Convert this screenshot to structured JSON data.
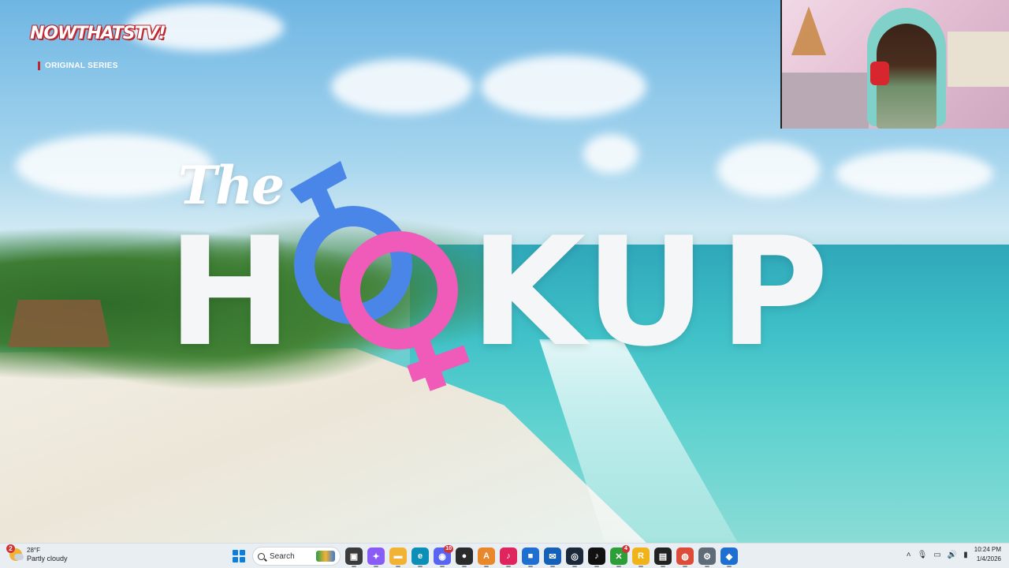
{
  "video": {
    "brand_logo": "NOWTHATSTV!",
    "brand_subtitle": "ORIGINAL SERIES",
    "show_title_prefix": "The",
    "show_title_letters": [
      "H",
      "O",
      "O",
      "K",
      "U",
      "P"
    ],
    "male_symbol_color": "#4a86e8",
    "female_symbol_color": "#f05ab8"
  },
  "webcam": {
    "accent": "#7fd1c9"
  },
  "taskbar": {
    "weather": {
      "badge": "2",
      "temperature": "28°F",
      "description": "Partly cloudy"
    },
    "search_placeholder": "Search",
    "apps": [
      {
        "name": "task-view",
        "glyph": "▣",
        "color": "#3b3b3b"
      },
      {
        "name": "copilot",
        "glyph": "✦",
        "color": "#8a5cf6"
      },
      {
        "name": "file-explorer",
        "glyph": "▬",
        "color": "#f2b233"
      },
      {
        "name": "edge",
        "glyph": "e",
        "color": "#0c8fb6"
      },
      {
        "name": "discord",
        "glyph": "◉",
        "color": "#5865f2",
        "badge": "10"
      },
      {
        "name": "obs",
        "glyph": "●",
        "color": "#2b2b2b"
      },
      {
        "name": "app-orange",
        "glyph": "A",
        "color": "#e9872b"
      },
      {
        "name": "app-red",
        "glyph": "♪",
        "color": "#e0245e"
      },
      {
        "name": "store",
        "glyph": "■",
        "color": "#1f6fd1"
      },
      {
        "name": "mail-app",
        "glyph": "✉",
        "color": "#1561b8"
      },
      {
        "name": "steam",
        "glyph": "◎",
        "color": "#1b2838"
      },
      {
        "name": "tiktok",
        "glyph": "♪",
        "color": "#111111"
      },
      {
        "name": "xbox",
        "glyph": "✕",
        "color": "#2e9e38",
        "badge": "4"
      },
      {
        "name": "rockstar",
        "glyph": "R",
        "color": "#f1b31a"
      },
      {
        "name": "call-of-duty",
        "glyph": "▤",
        "color": "#222222"
      },
      {
        "name": "chrome",
        "glyph": "◍",
        "color": "#dd4b39"
      },
      {
        "name": "settings",
        "glyph": "⚙",
        "color": "#5f6b77"
      },
      {
        "name": "defender",
        "glyph": "◆",
        "color": "#1f6fd1"
      }
    ],
    "tray": {
      "overflow_glyph": "˄",
      "clock_time": "10:24 PM",
      "clock_date": "1/4/2026"
    }
  }
}
